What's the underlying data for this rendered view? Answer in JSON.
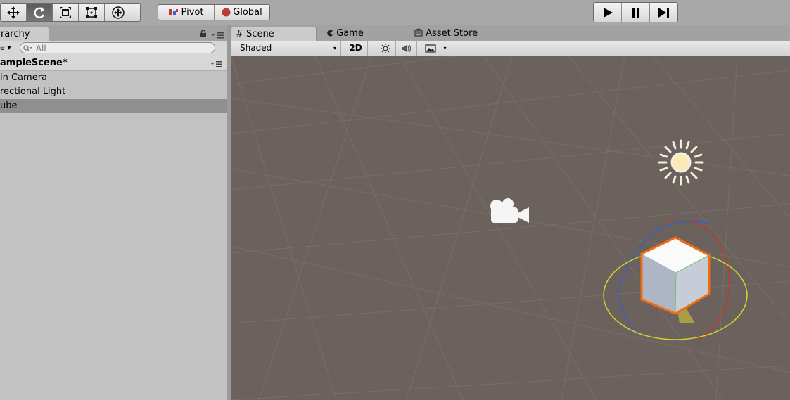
{
  "toolbar": {
    "transform_tools": [
      "move-tool",
      "rotate-tool",
      "scale-tool",
      "rect-tool",
      "transform-tool"
    ],
    "active_tool": "rotate-tool",
    "pivot_label": "Pivot",
    "global_label": "Global",
    "play_controls": [
      "play-icon",
      "pause-icon",
      "step-icon"
    ]
  },
  "hierarchy": {
    "tab_label": "rarchy",
    "create_label": "e ▾",
    "search_placeholder": "All",
    "scene_name": "ampleScene*",
    "items": [
      {
        "label": "in Camera",
        "selected": false
      },
      {
        "label": "rectional Light",
        "selected": false
      },
      {
        "label": "ube",
        "selected": true
      }
    ]
  },
  "scene_view": {
    "tabs": [
      {
        "label": "Scene",
        "icon": "grid-icon",
        "active": true
      },
      {
        "label": "Game",
        "icon": "pacman-icon",
        "active": false
      },
      {
        "label": "Asset Store",
        "icon": "bag-icon",
        "active": false
      }
    ],
    "shading_mode": "Shaded",
    "mode_2d_label": "2D",
    "gizmos": [
      "camera-gizmo-icon",
      "directional-light-gizmo-icon",
      "selected-cube"
    ],
    "colors": {
      "viewport_bg": "#6b625e",
      "selection_outline": "#f26b0f",
      "gizmo_yellow": "#d8d32a",
      "gizmo_red": "#c43a22",
      "gizmo_blue": "#3a5fbf"
    }
  }
}
